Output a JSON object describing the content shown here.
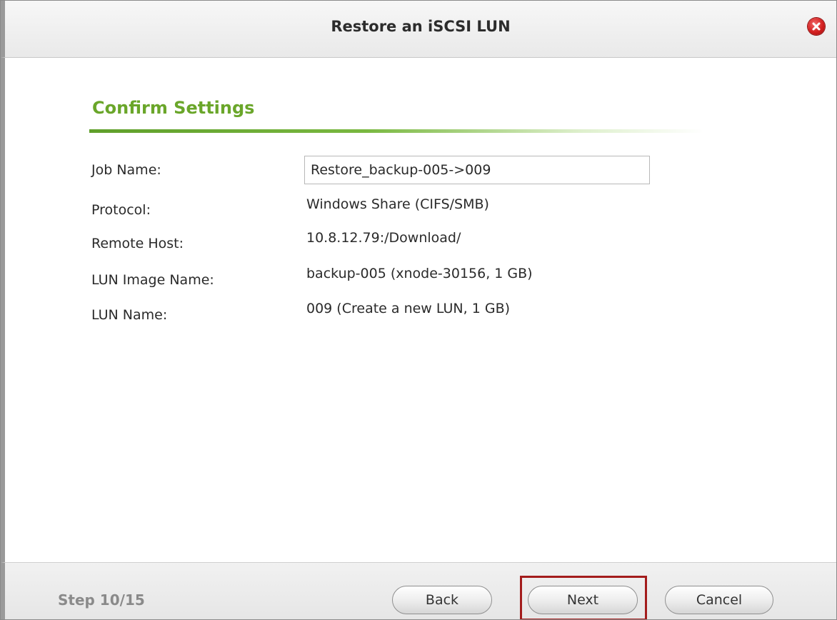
{
  "dialog": {
    "title": "Restore an iSCSI LUN",
    "close_icon": "close-icon"
  },
  "section": {
    "title": "Confirm Settings"
  },
  "fields": {
    "job_name_label": "Job Name:",
    "job_name_value": "Restore_backup-005->009",
    "protocol_label": "Protocol:",
    "protocol_value": "Windows Share (CIFS/SMB)",
    "remote_host_label": "Remote Host:",
    "remote_host_value": "10.8.12.79:/Download/",
    "lun_image_label": "LUN Image Name:",
    "lun_image_value": "backup-005 (xnode-30156, 1 GB)",
    "lun_name_label": "LUN Name:",
    "lun_name_value": "009 (Create a new LUN, 1 GB)"
  },
  "footer": {
    "step": "Step 10/15",
    "back_label": "Back",
    "next_label": "Next",
    "cancel_label": "Cancel"
  },
  "colors": {
    "accent_green": "#6aa62a",
    "highlight_red": "#a31c1c",
    "close_red": "#d21f1f"
  }
}
